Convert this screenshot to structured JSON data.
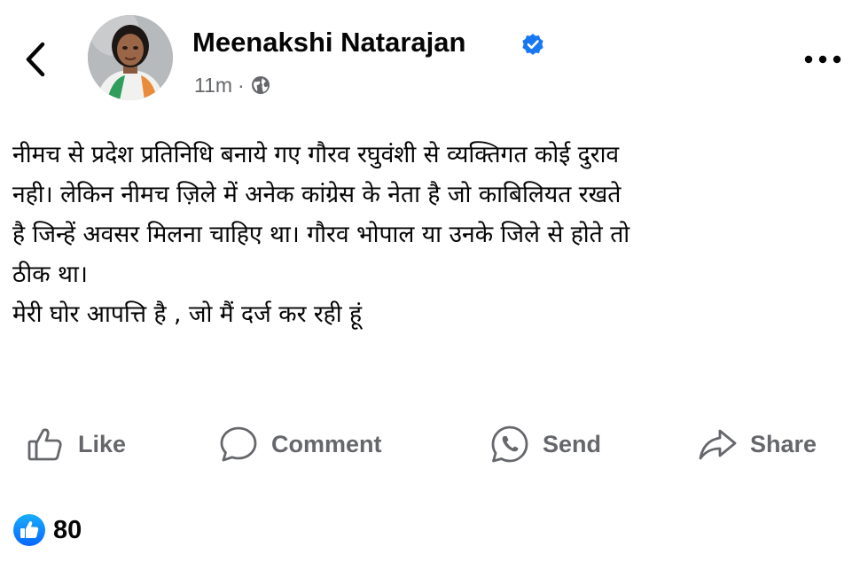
{
  "header": {
    "author_name": "Meenakshi Natarajan",
    "time": "11m",
    "separator": "·",
    "privacy_icon": "globe-icon",
    "verified_icon": "verified-badge-icon",
    "back_icon": "chevron-left-icon",
    "more_icon": "more-horizontal-icon"
  },
  "post": {
    "lines": [
      "नीमच से प्रदेश प्रतिनिधि बनाये गए गौरव रघुवंशी से व्यक्तिगत कोई दुराव",
      "नही। लेकिन नीमच ज़िले में अनेक कांग्रेस के नेता है जो काबिलियत रखते",
      "है जिन्हें अवसर मिलना चाहिए था। गौरव भोपाल या उनके जिले से होते तो",
      "ठीक था।",
      "मेरी घोर आपत्ति है , जो मैं दर्ज कर रही हूं"
    ]
  },
  "actions": {
    "like": "Like",
    "comment": "Comment",
    "send": "Send",
    "share": "Share"
  },
  "reactions": {
    "count": "80",
    "icon": "thumbs-up-reaction-icon"
  },
  "colors": {
    "accent": "#1877f2",
    "secondary_text": "#65676b",
    "primary_text": "#050505",
    "background": "#ffffff"
  }
}
